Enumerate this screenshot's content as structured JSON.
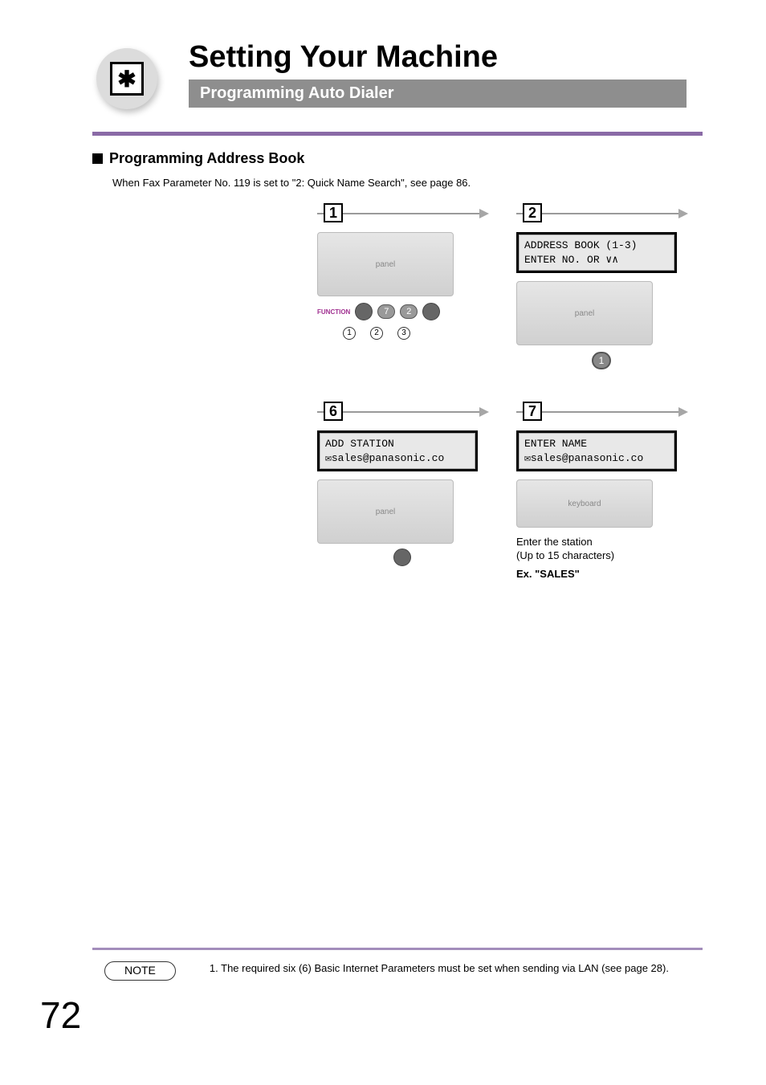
{
  "page": {
    "title": "Setting Your Machine",
    "subtitle": "Programming Auto Dialer",
    "sectionHeading": "Programming Address Book",
    "intro": "When Fax Parameter No. 119 is set to \"2: Quick Name Search\", see page 86.",
    "pageNumber": "72"
  },
  "steps": {
    "s1": {
      "num": "1"
    },
    "s2": {
      "num": "2",
      "lcd1": "ADDRESS BOOK (1-3)",
      "lcd2": "ENTER NO. OR ∨∧",
      "keypress": "1"
    },
    "s6": {
      "num": "6",
      "lcd1": "ADD STATION",
      "lcd2": "✉sales@panasonic.co"
    },
    "s7": {
      "num": "7",
      "lcd1": "ENTER NAME",
      "lcd2": "✉sales@panasonic.co",
      "caption1": "Enter the station",
      "caption2": "(Up to 15 characters)",
      "example": "Ex. \"SALES\""
    }
  },
  "functionPanel": {
    "label": "FUNCTION",
    "key7": "7",
    "key2": "2",
    "c1": "1",
    "c2": "2",
    "c3": "3"
  },
  "note": {
    "label": "NOTE",
    "listNum": "1.",
    "text": "The required six (6) Basic Internet Parameters must be set when sending via LAN (see page 28)."
  }
}
